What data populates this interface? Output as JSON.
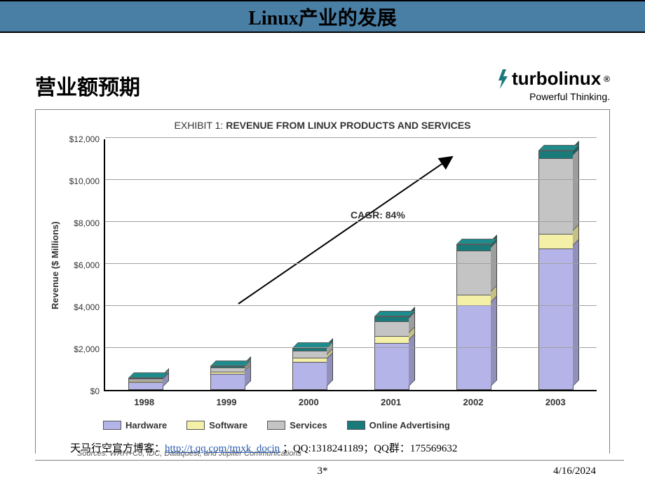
{
  "header": {
    "title": "Linux产业的发展"
  },
  "subhead": "营业额预期",
  "logo": {
    "brand": "turbolinux",
    "suffix": "®",
    "tagline": "Powerful Thinking."
  },
  "chart": {
    "title_prefix": "EXHIBIT 1: ",
    "title_main": "REVENUE FROM LINUX PRODUCTS AND SERVICES",
    "ylabel": "Revenue ($ Millions)",
    "annotation": "CAGR: 84%",
    "sources": "Sources: WRH+Co, IDC, Dataquest, and Jupiter Communications"
  },
  "legend": {
    "hardware": "Hardware",
    "software": "Software",
    "services": "Services",
    "online": "Online Advertising"
  },
  "colors": {
    "hardware": "#b4b4e8",
    "software": "#f5f0a8",
    "services": "#c4c4c4",
    "online": "#1a7a7a"
  },
  "footer": {
    "attr_prefix": "天马行空官方博客：",
    "attr_link_text": "http://t.qq.com/tmxk_docin",
    "attr_suffix": " ；QQ:1318241189；QQ群：175569632",
    "page": "3*",
    "date": "4/16/2024"
  },
  "chart_data": {
    "type": "bar",
    "stacked": true,
    "title": "EXHIBIT 1: REVENUE FROM LINUX PRODUCTS AND SERVICES",
    "xlabel": "",
    "ylabel": "Revenue ($ Millions)",
    "ylim": [
      0,
      12000
    ],
    "yticks": [
      0,
      2000,
      4000,
      6000,
      8000,
      10000,
      12000
    ],
    "ytick_labels": [
      "$0",
      "$2,000",
      "$4,000",
      "$6,000",
      "$8,000",
      "$10,000",
      "$12,000"
    ],
    "categories": [
      "1998",
      "1999",
      "2000",
      "2001",
      "2002",
      "2003"
    ],
    "series": [
      {
        "name": "Hardware",
        "values": [
          350,
          750,
          1300,
          2200,
          4000,
          6700
        ]
      },
      {
        "name": "Software",
        "values": [
          50,
          100,
          200,
          350,
          500,
          700
        ]
      },
      {
        "name": "Services",
        "values": [
          100,
          200,
          350,
          700,
          2100,
          3600
        ]
      },
      {
        "name": "Online Advertising",
        "values": [
          50,
          100,
          150,
          250,
          350,
          400
        ]
      }
    ],
    "annotation": "CAGR: 84%",
    "sources": "WRH+Co, IDC, Dataquest, and Jupiter Communications"
  }
}
